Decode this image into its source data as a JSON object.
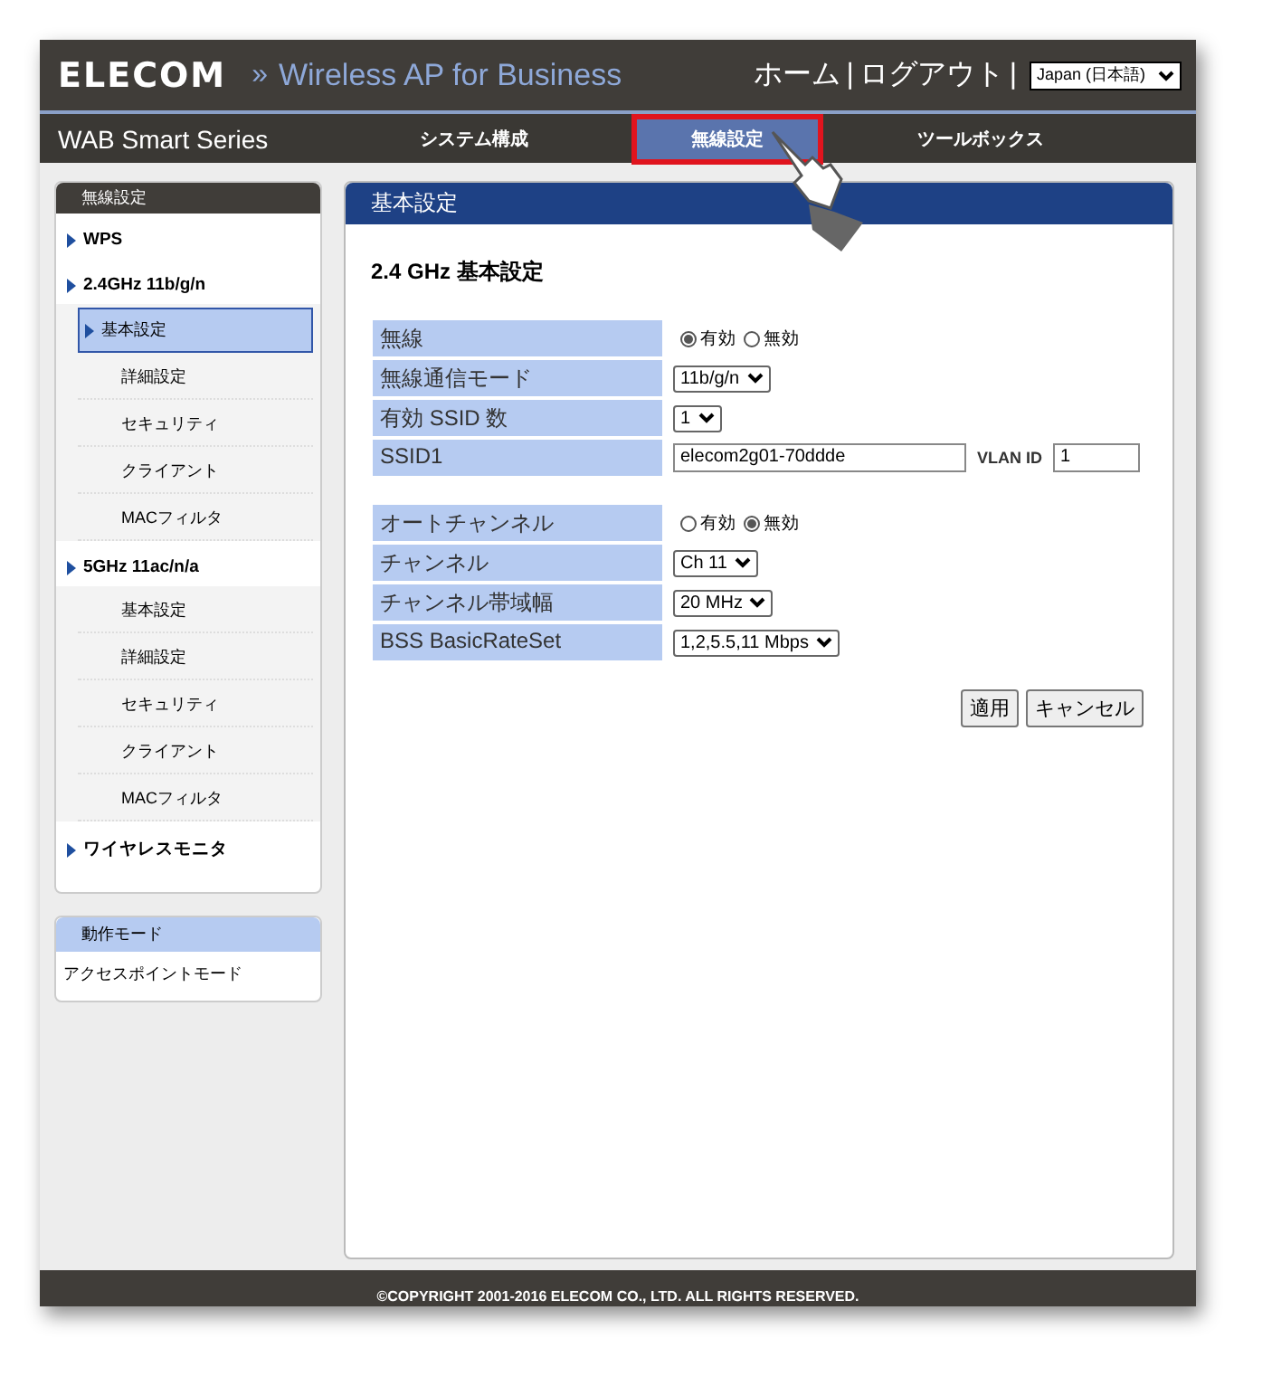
{
  "header": {
    "logo": "ELECOM",
    "separator": "»",
    "title": "Wireless AP for Business",
    "links": [
      {
        "label": "ホーム"
      },
      {
        "label": "|"
      },
      {
        "label": "ログアウト"
      },
      {
        "label": "|"
      }
    ],
    "language": "Japan (日本語)"
  },
  "nav": {
    "brand": "WAB Smart Series",
    "tabs": [
      {
        "label": "システム構成",
        "selected": false
      },
      {
        "label": "無線設定",
        "selected": true
      },
      {
        "label": "ツールボックス",
        "selected": false
      }
    ]
  },
  "sidebar": {
    "title": "無線設定",
    "groups": [
      {
        "label": "WPS"
      },
      {
        "label": "2.4GHz 11b/g/n",
        "children": [
          {
            "label": "基本設定",
            "selected": true
          },
          {
            "label": "詳細設定",
            "selected": false
          },
          {
            "label": "セキュリティ",
            "selected": false
          },
          {
            "label": "クライアント",
            "selected": false
          },
          {
            "label": "MACフィルタ",
            "selected": false
          }
        ]
      },
      {
        "label": "5GHz 11ac/n/a",
        "children": [
          {
            "label": "基本設定",
            "selected": false
          },
          {
            "label": "詳細設定",
            "selected": false
          },
          {
            "label": "セキュリティ",
            "selected": false
          },
          {
            "label": "クライアント",
            "selected": false
          },
          {
            "label": "MACフィルタ",
            "selected": false
          }
        ]
      },
      {
        "label": "ワイヤレスモニタ"
      }
    ]
  },
  "mode_box": {
    "title": "動作モード",
    "value": "アクセスポイントモード"
  },
  "panel": {
    "title": "基本設定",
    "heading": "2.4 GHz 基本設定",
    "sections": [
      [
        {
          "label": "無線",
          "kind": "radio",
          "options": [
            {
              "label": "有効",
              "selected": true
            },
            {
              "label": "無効",
              "selected": false
            }
          ]
        },
        {
          "label": "無線通信モード",
          "kind": "select",
          "value": "11b/g/n"
        },
        {
          "label": "有効 SSID 数",
          "kind": "select",
          "value": "1"
        },
        {
          "label": "SSID1",
          "kind": "text",
          "value": "elecom2g01-70ddde",
          "extra_label": "VLAN ID",
          "extra_value": "1"
        }
      ],
      [
        {
          "label": "オートチャンネル",
          "kind": "radio",
          "options": [
            {
              "label": "有効",
              "selected": false
            },
            {
              "label": "無効",
              "selected": true
            }
          ]
        },
        {
          "label": "チャンネル",
          "kind": "select",
          "value": "Ch 11"
        },
        {
          "label": "チャンネル帯域幅",
          "kind": "select",
          "value": "20 MHz"
        },
        {
          "label": "BSS BasicRateSet",
          "kind": "select",
          "value": "1,2,5.5,11 Mbps"
        }
      ]
    ],
    "buttons": [
      "適用",
      "キャンセル"
    ]
  },
  "footer": "©COPYRIGHT 2001-2016 ELECOM CO., LTD. ALL RIGHTS RESERVED."
}
